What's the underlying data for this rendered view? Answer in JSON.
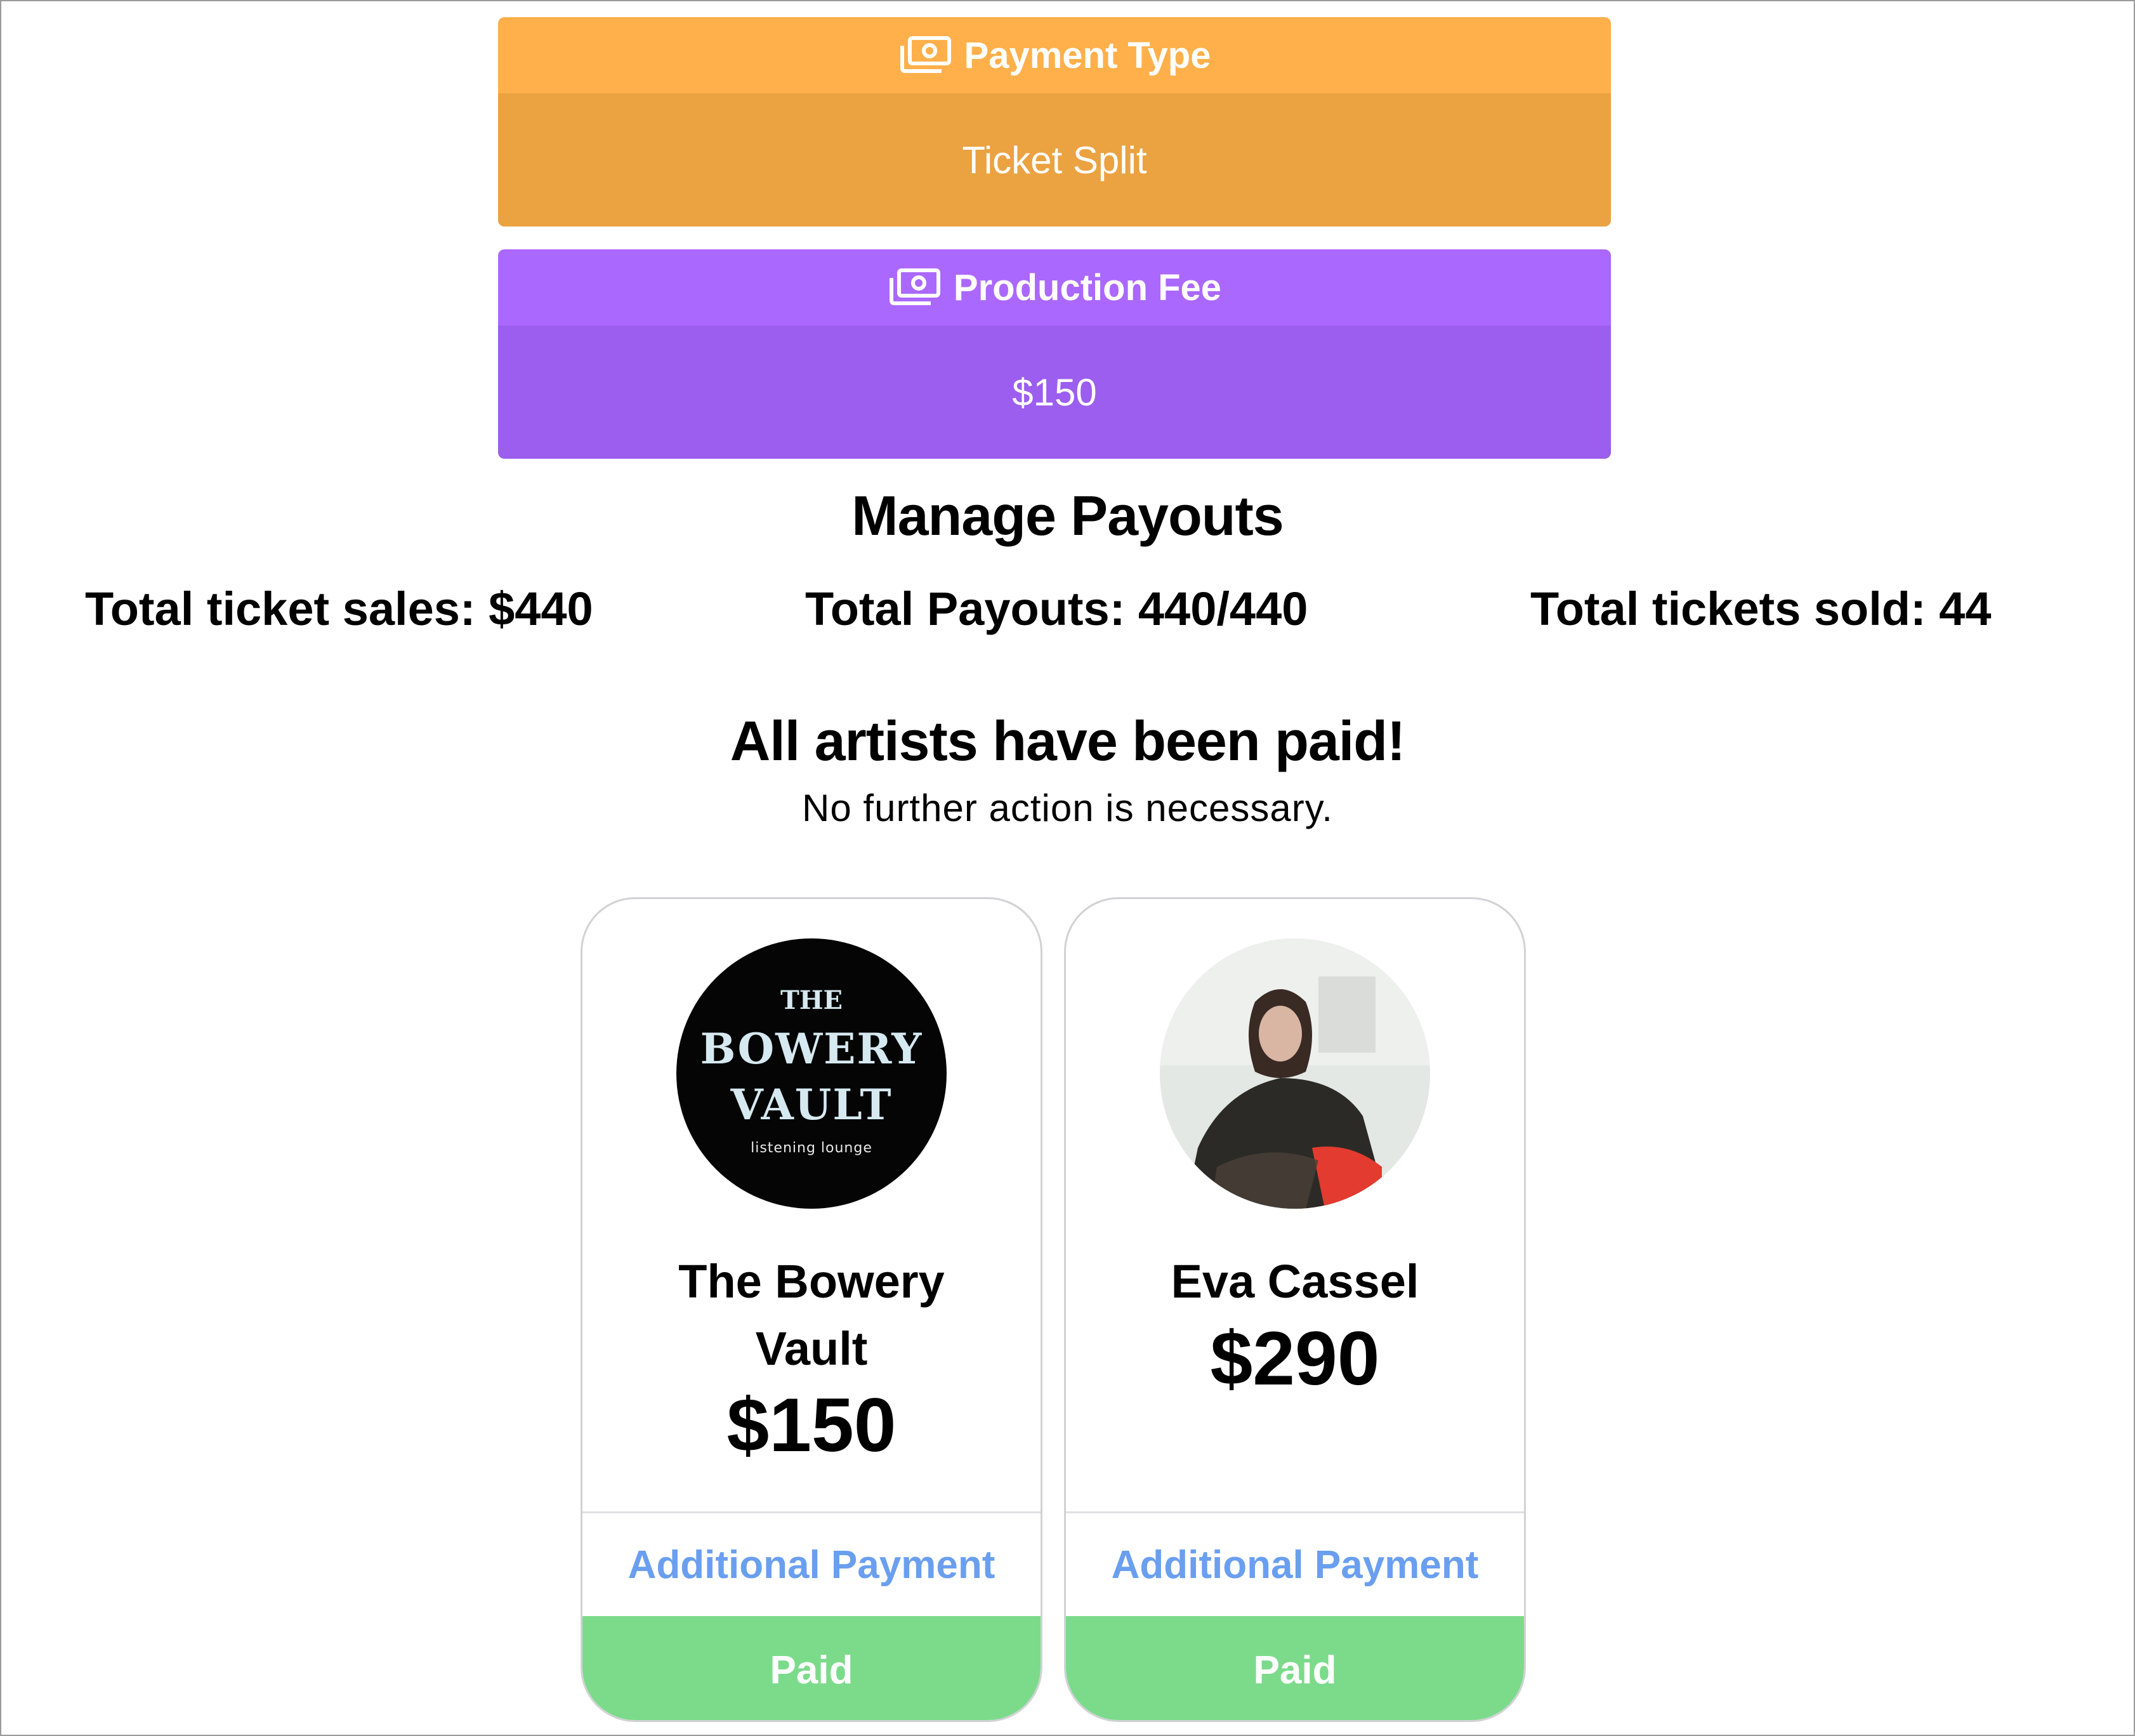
{
  "payment_type": {
    "label": "Payment Type",
    "value": "Ticket Split",
    "icon": "money-icon",
    "header_color": "#FFB04B",
    "body_color": "#EBA241"
  },
  "production_fee": {
    "label": "Production Fee",
    "value": "$150",
    "icon": "money-icon",
    "header_color": "#AB68FF",
    "body_color": "#9C5EEE"
  },
  "payouts": {
    "title": "Manage Payouts",
    "total_ticket_sales": "Total ticket sales: $440",
    "total_payouts": "Total Payouts: 440/440",
    "total_tickets_sold": "Total tickets sold: 44"
  },
  "status": {
    "title": "All artists have been paid!",
    "subtitle": "No further action is necessary."
  },
  "artists": [
    {
      "name": "The Bowery Vault",
      "amount": "$150",
      "avatar": {
        "the": "THE",
        "name_line1": "BOWERY",
        "name_line2": "VAULT",
        "tagline": "listening lounge"
      },
      "additional_payment_label": "Additional Payment",
      "status_label": "Paid"
    },
    {
      "name": "Eva Cassel",
      "amount": "$290",
      "avatar": "artist-photo",
      "additional_payment_label": "Additional Payment",
      "status_label": "Paid"
    }
  ],
  "colors": {
    "link": "#6A9FF0",
    "paid": "#7CDB8B"
  }
}
